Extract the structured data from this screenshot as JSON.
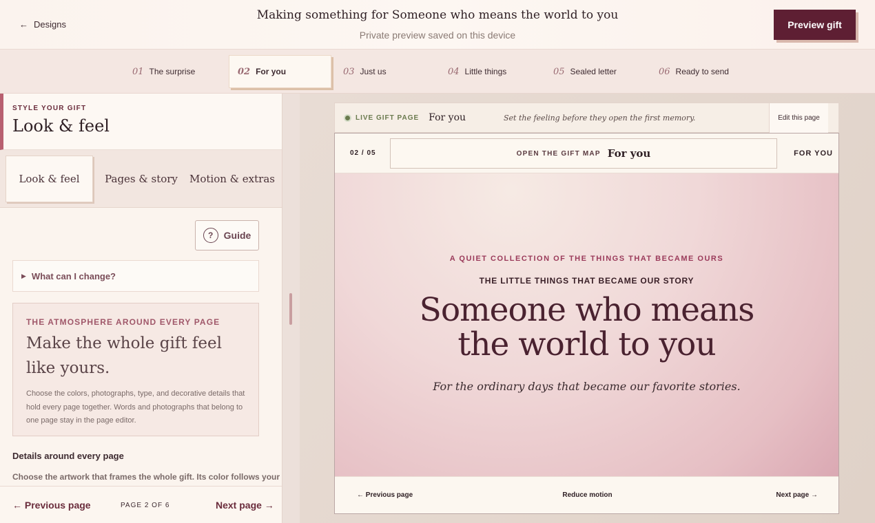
{
  "header": {
    "back_label": "Designs",
    "back_arrow": "←",
    "title": "Making something for Someone who means the world to you",
    "subtitle": "Private preview saved on this device",
    "preview_button": "Preview gift"
  },
  "steps": [
    {
      "num": "01",
      "label": "The surprise"
    },
    {
      "num": "02",
      "label": "For you"
    },
    {
      "num": "03",
      "label": "Just us"
    },
    {
      "num": "04",
      "label": "Little things"
    },
    {
      "num": "05",
      "label": "Sealed letter"
    },
    {
      "num": "06",
      "label": "Ready to send"
    }
  ],
  "sidebar": {
    "eyebrow": "STYLE YOUR GIFT",
    "title": "Look & feel",
    "tabs": [
      {
        "label": "Look & feel"
      },
      {
        "label": "Pages & story"
      },
      {
        "label": "Motion & extras"
      }
    ],
    "guide_button": "Guide",
    "guide_icon_glyph": "?",
    "details_summary": "What can I change?",
    "card": {
      "eyebrow": "THE ATMOSPHERE AROUND EVERY PAGE",
      "title": "Make the whole gift feel like yours.",
      "body": "Choose the colors, photographs, type, and decorative details that hold every page together. Words and photographs that belong to one page stay in the page editor."
    },
    "section_heading": "Details around every page",
    "section_text": "Choose the artwork that frames the whole gift. Its color follows your",
    "footer": {
      "prev": "← Previous page",
      "page": "PAGE 2 OF 6",
      "next": "Next page →"
    }
  },
  "live_bar": {
    "label": "LIVE GIFT PAGE",
    "page": "For you",
    "hint": "Set the feeling before they open the first memory.",
    "edit_button": "Edit this page"
  },
  "gift": {
    "count": "02 / 05",
    "map_label": "OPEN THE GIFT MAP",
    "map_page": "For you",
    "right_label": "FOR YOU",
    "eyebrow": "A QUIET COLLECTION OF THE THINGS THAT BECAME OURS",
    "subheading": "THE LITTLE THINGS THAT BECAME OUR STORY",
    "title_line1": "Someone who means",
    "title_line2": "the world to you",
    "quote": "For the ordinary days that became our favorite stories.",
    "footer": {
      "prev": "← Previous page",
      "motion": "Reduce motion",
      "next": "Next page →"
    }
  },
  "colors": {
    "brand": "#5e1f33",
    "accent": "#b86070",
    "live": "#6a7a4e"
  }
}
